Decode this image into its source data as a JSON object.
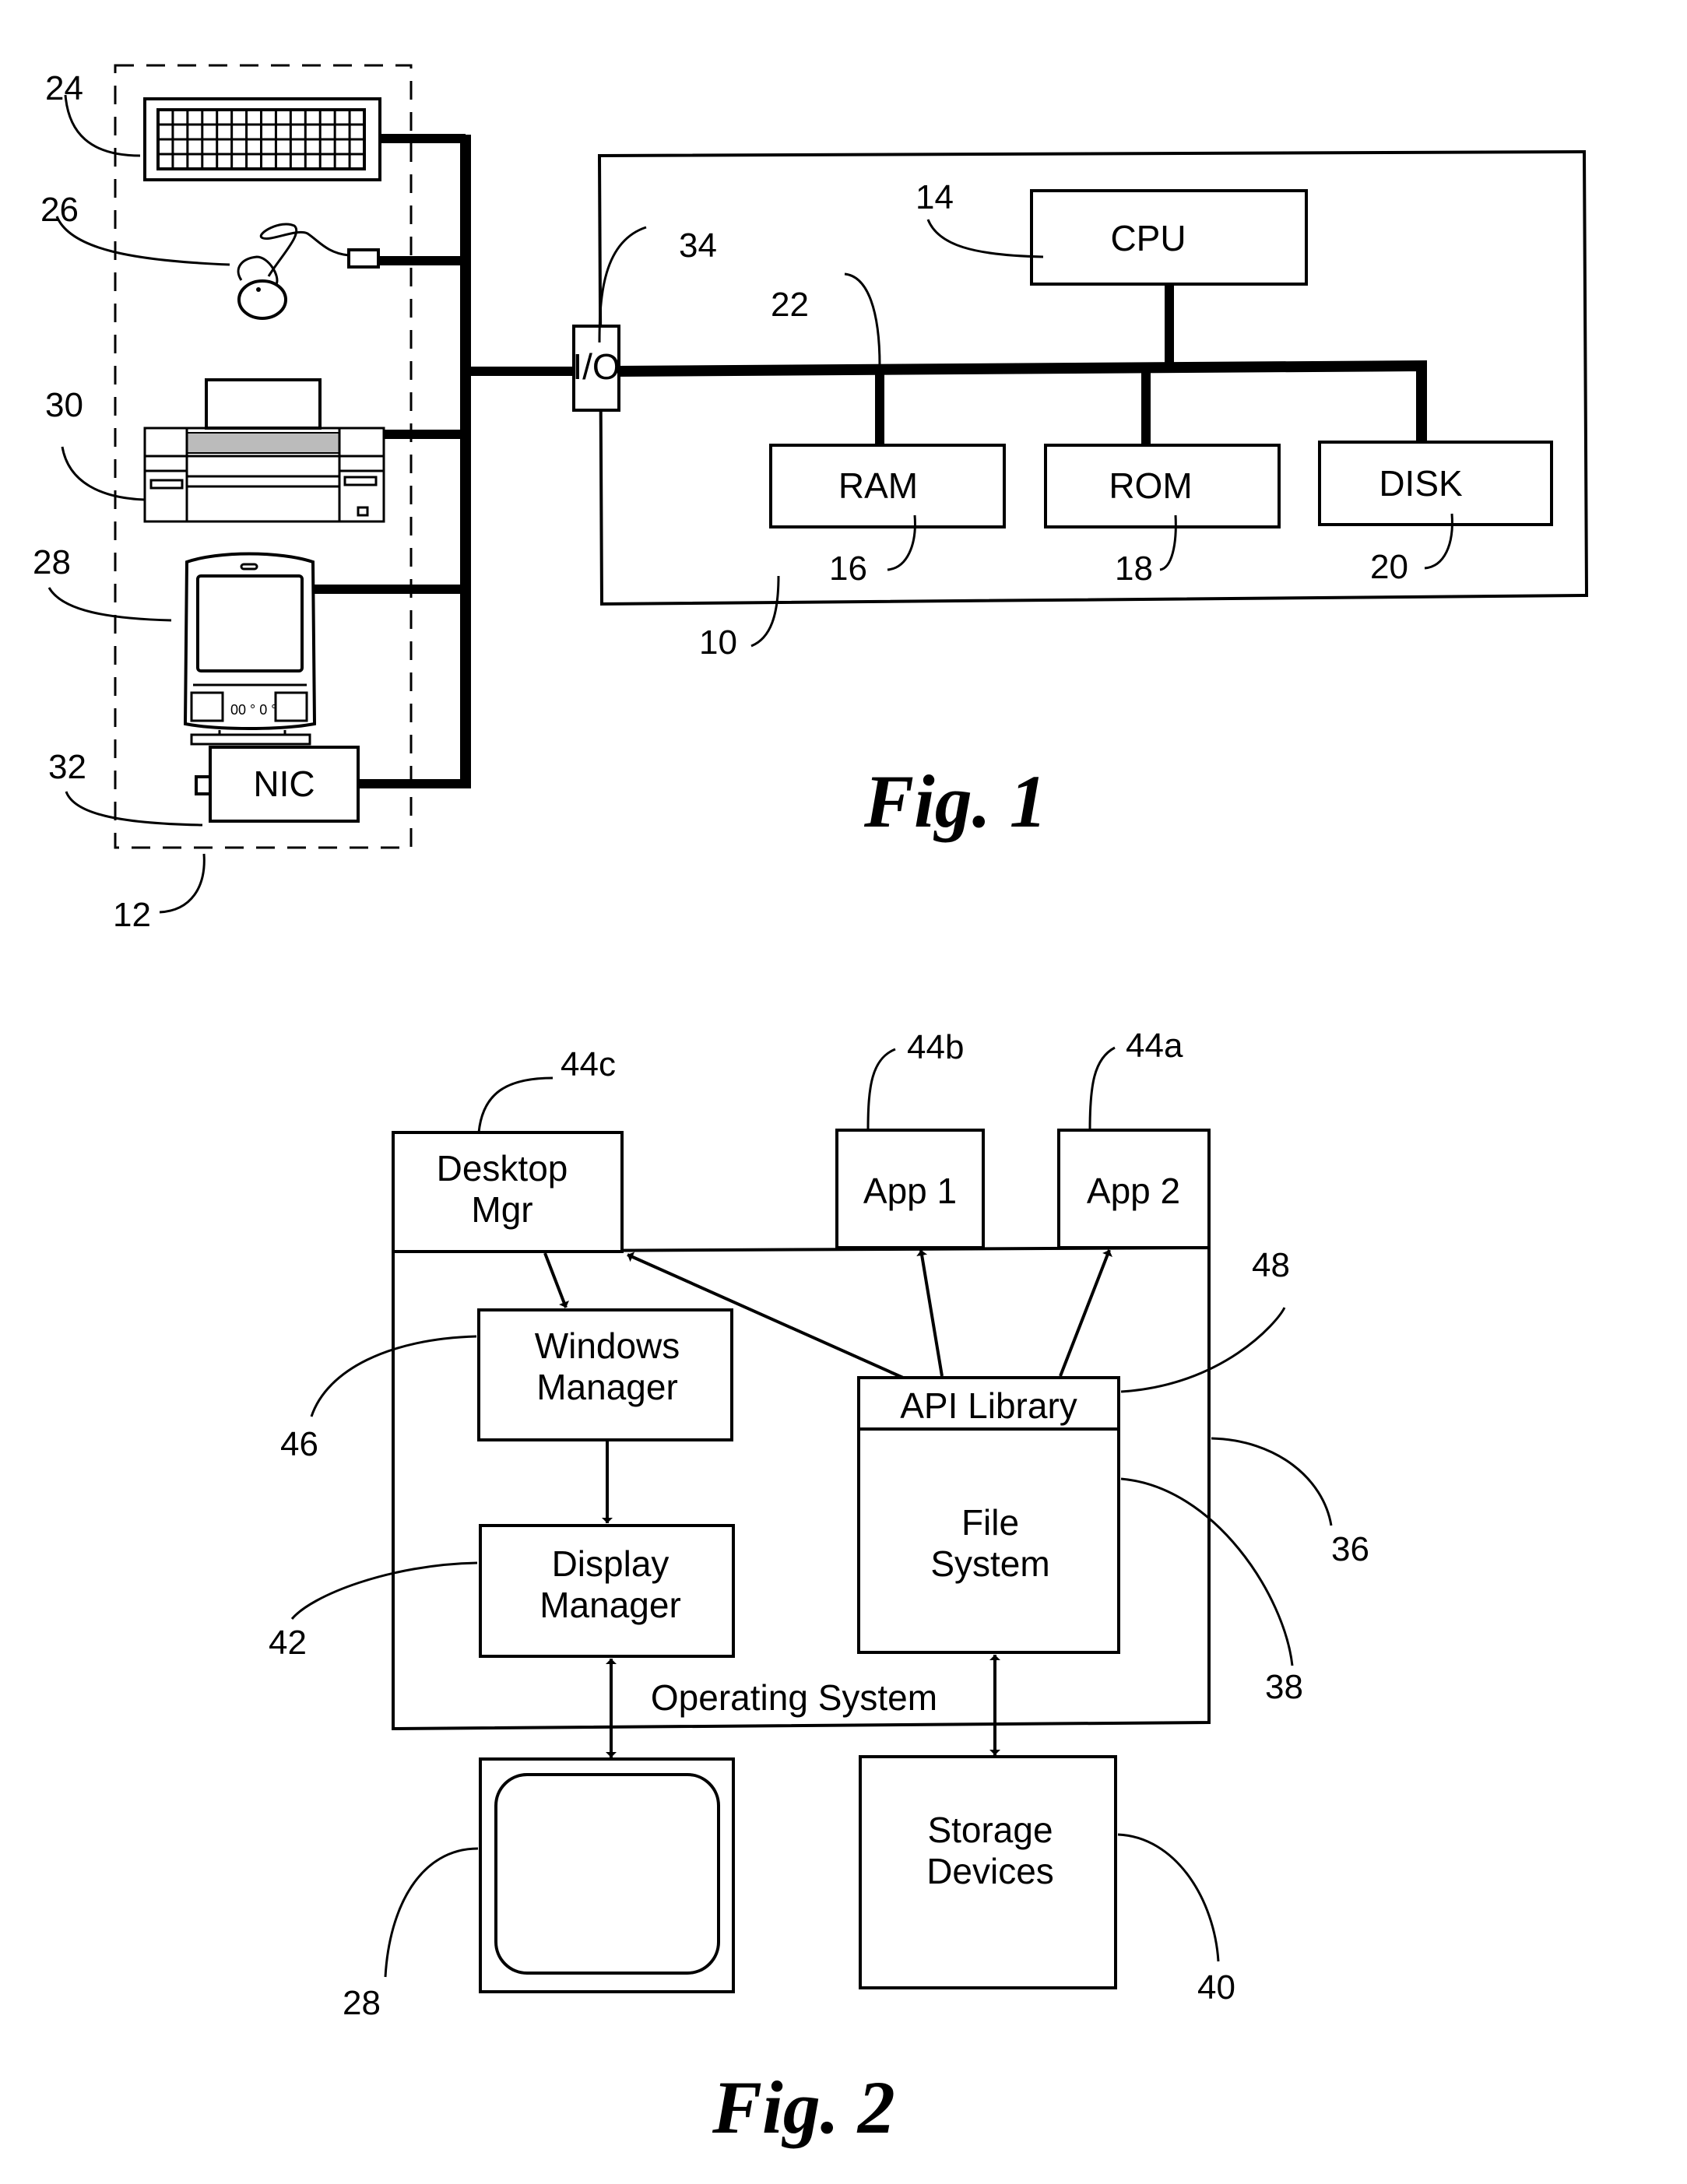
{
  "figure1": {
    "caption": "Fig. 1",
    "computer": {
      "ref": "10",
      "cpu": {
        "label": "CPU",
        "ref": "14"
      },
      "ram": {
        "label": "RAM",
        "ref": "16"
      },
      "rom": {
        "label": "ROM",
        "ref": "18"
      },
      "disk": {
        "label": "DISK",
        "ref": "20"
      },
      "bus_ref": "22",
      "io": {
        "label": "I/O",
        "ref": "34"
      }
    },
    "peripherals": {
      "ref": "12",
      "keyboard_ref": "24",
      "mouse_ref": "26",
      "printer_ref": "30",
      "display_ref": "28",
      "nic": {
        "label": "NIC",
        "ref": "32"
      }
    }
  },
  "figure2": {
    "caption": "Fig. 2",
    "os": {
      "label": "Operating System",
      "ref": "36"
    },
    "desktop_mgr": {
      "line1": "Desktop",
      "line2": "Mgr",
      "ref": "44c"
    },
    "app1": {
      "label": "App 1",
      "ref": "44b"
    },
    "app2": {
      "label": "App 2",
      "ref": "44a"
    },
    "windows_manager": {
      "line1": "Windows",
      "line2": "Manager",
      "ref": "46"
    },
    "display_manager": {
      "line1": "Display",
      "line2": "Manager",
      "ref": "42"
    },
    "api_library": {
      "label": "API Library",
      "ref": "48"
    },
    "file_system": {
      "line1": "File",
      "line2": "System",
      "ref": "38"
    },
    "display": {
      "ref": "28"
    },
    "storage": {
      "line1": "Storage",
      "line2": "Devices",
      "ref": "40"
    }
  }
}
